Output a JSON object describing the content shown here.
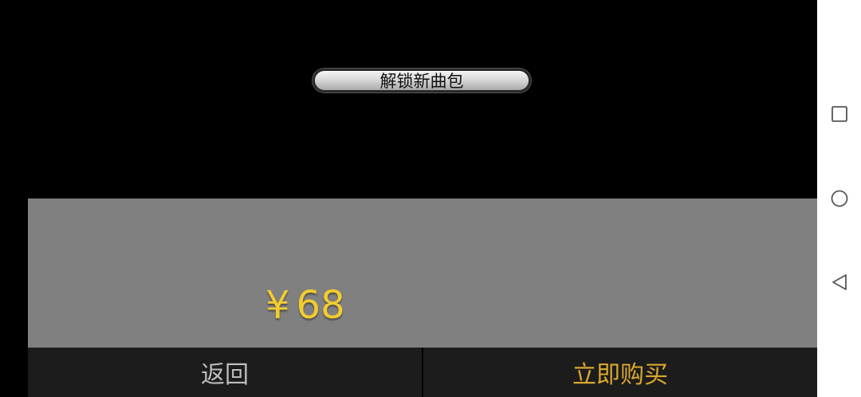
{
  "header": {
    "title": "解锁新曲包"
  },
  "offer": {
    "currency_symbol": "¥",
    "price": "68",
    "price_color": "#f2cc2e"
  },
  "actions": {
    "back_label": "返回",
    "buy_label": "立即购买",
    "buy_color": "#d9a82e"
  },
  "system_nav": {
    "buttons": [
      {
        "name": "recent-apps",
        "icon": "square-icon"
      },
      {
        "name": "home",
        "icon": "circle-icon"
      },
      {
        "name": "back",
        "icon": "triangle-left-icon"
      }
    ]
  }
}
